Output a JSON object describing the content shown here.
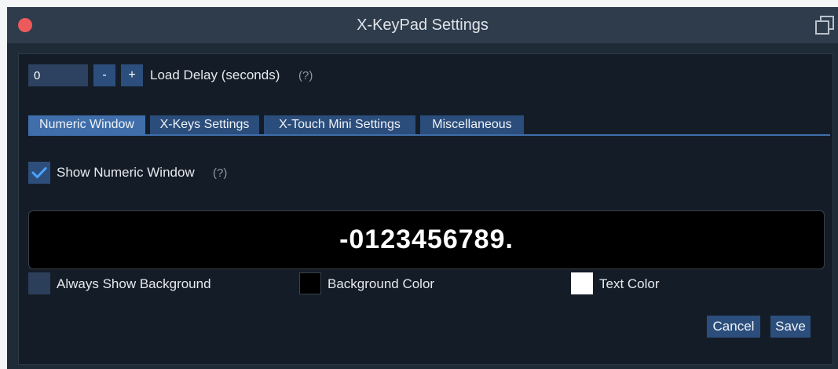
{
  "window": {
    "title": "X-KeyPad Settings",
    "close_color": "#ed5a5b"
  },
  "load_delay": {
    "value": "0",
    "minus_label": "-",
    "plus_label": "+",
    "label": "Load Delay (seconds)",
    "help": "(?)"
  },
  "tabs": [
    {
      "label": "Numeric Window",
      "active": true
    },
    {
      "label": "X-Keys Settings",
      "active": false
    },
    {
      "label": "X-Touch Mini Settings",
      "active": false
    },
    {
      "label": "Miscellaneous",
      "active": false
    }
  ],
  "numeric_window": {
    "show_label": "Show Numeric Window",
    "show_checked": true,
    "help": "(?)",
    "display_text": "-0123456789.",
    "always_show_background_label": "Always Show Background",
    "always_show_background_checked": false,
    "background_color_label": "Background Color",
    "background_color": "#000000",
    "text_color_label": "Text Color",
    "text_color": "#ffffff"
  },
  "buttons": {
    "cancel": "Cancel",
    "save": "Save"
  },
  "icons": {
    "close": "close-icon",
    "popout": "popout-icon",
    "check": "checkmark-icon"
  }
}
